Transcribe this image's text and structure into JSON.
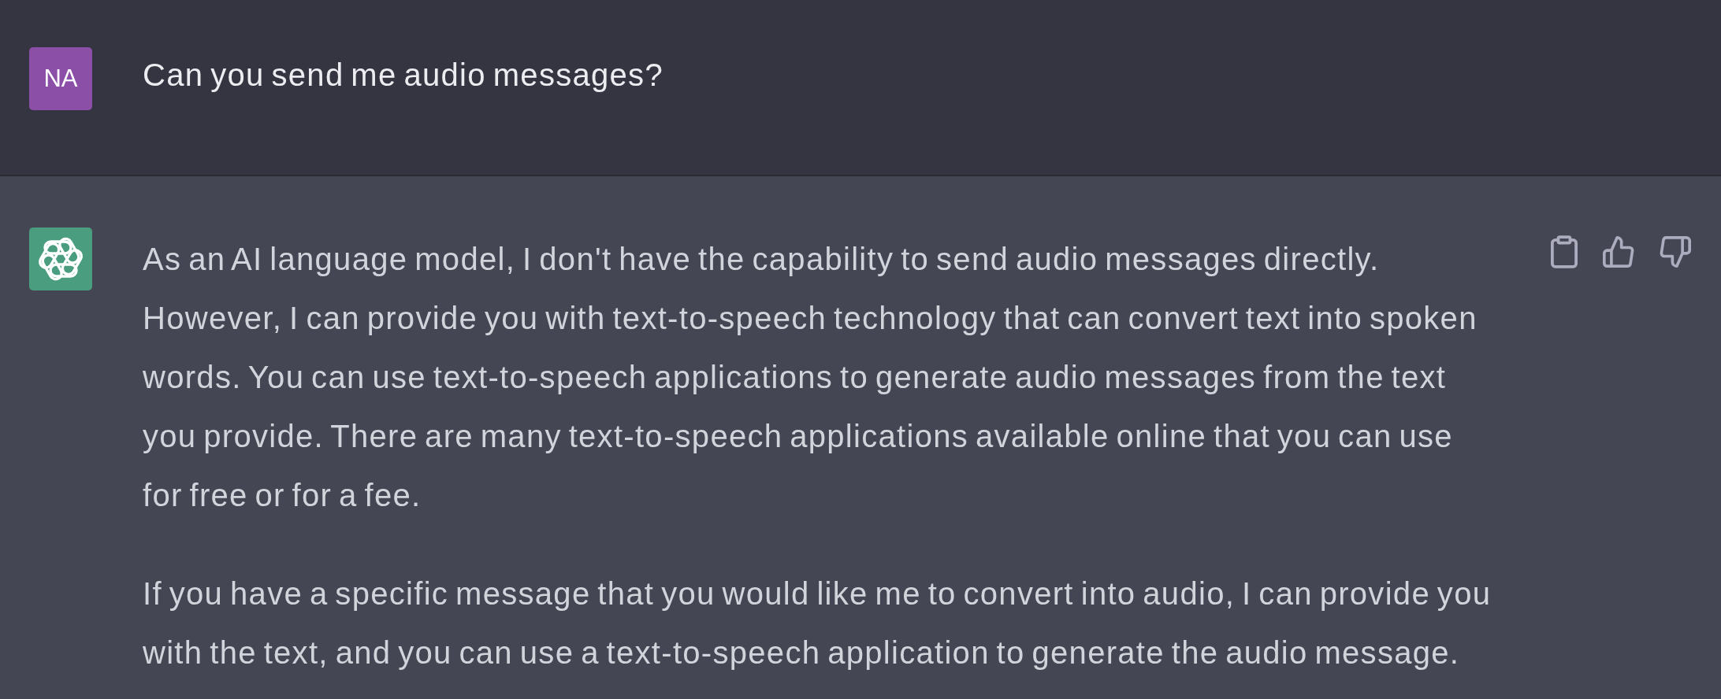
{
  "conversation": [
    {
      "kind": "user",
      "avatar_text": "NA",
      "paragraphs": [
        "Can you send me audio messages?"
      ]
    },
    {
      "kind": "assistant",
      "paragraphs": [
        "As an AI language model, I don't have the capability to send audio messages directly. However, I can provide you with text-to-speech technology that can convert text into spoken words. You can use text-to-speech applications to generate audio messages from the text you provide. There are many text-to-speech applications available online that you can use for free or for a fee.",
        "If you have a specific message that you would like me to convert into audio, I can provide you with the text, and you can use a text-to-speech application to generate the audio message."
      ],
      "actions": [
        {
          "kind": "copy"
        },
        {
          "kind": "thumbs_up"
        },
        {
          "kind": "thumbs_down"
        }
      ]
    }
  ]
}
